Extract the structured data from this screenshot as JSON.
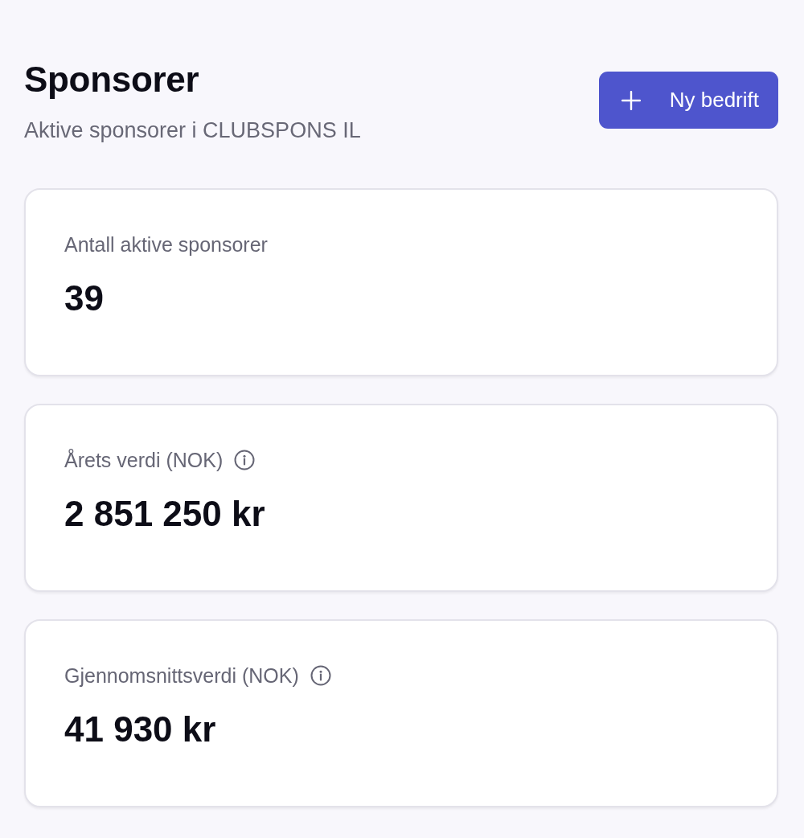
{
  "header": {
    "title": "Sponsorer",
    "subtitle": "Aktive sponsorer i CLUBSPONS IL",
    "button": {
      "label": "Ny bedrift"
    }
  },
  "cards": [
    {
      "label": "Antall aktive sponsorer",
      "info_icon": false,
      "value": "39"
    },
    {
      "label": "Årets verdi (NOK)",
      "info_icon": true,
      "value": "2 851 250 kr"
    },
    {
      "label": "Gjennomsnittsverdi (NOK)",
      "info_icon": true,
      "value": "41 930 kr"
    }
  ]
}
